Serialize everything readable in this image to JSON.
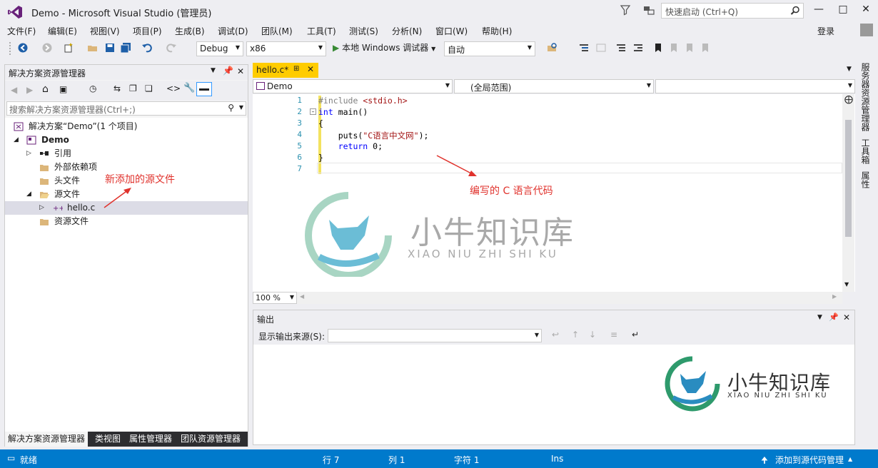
{
  "window": {
    "title": "Demo - Microsoft Visual Studio (管理员)",
    "quick_launch_placeholder": "快速启动 (Ctrl+Q)",
    "login_label": "登录"
  },
  "menu": [
    "文件(F)",
    "编辑(E)",
    "视图(V)",
    "项目(P)",
    "生成(B)",
    "调试(D)",
    "团队(M)",
    "工具(T)",
    "测试(S)",
    "分析(N)",
    "窗口(W)",
    "帮助(H)"
  ],
  "toolbar": {
    "configuration": "Debug",
    "platform": "x86",
    "run_label": "本地 Windows 调试器",
    "auto_label": "自动"
  },
  "solution_explorer": {
    "title": "解决方案资源管理器",
    "search_placeholder": "搜索解决方案资源管理器(Ctrl+;)",
    "tree": [
      {
        "label": "解决方案“Demo”(1 个项目)"
      },
      {
        "label": "Demo"
      },
      {
        "label": "引用"
      },
      {
        "label": "外部依赖项"
      },
      {
        "label": "头文件"
      },
      {
        "label": "源文件"
      },
      {
        "label": "hello.c"
      },
      {
        "label": "资源文件"
      }
    ],
    "tabs": [
      "解决方案资源管理器",
      "类视图",
      "属性管理器",
      "团队资源管理器"
    ]
  },
  "annotations": {
    "new_source": "新添加的源文件",
    "code_note": "编写的 C 语言代码"
  },
  "editor": {
    "tab_label": "hello.c*",
    "nav_project": "Demo",
    "nav_scope": "(全局范围)",
    "nav_member": "",
    "zoom": "100 %",
    "line_numbers": [
      "1",
      "2",
      "3",
      "4",
      "5",
      "6",
      "7"
    ],
    "lines": {
      "l1_pp": "#include ",
      "l1_inc": "<stdio.h>",
      "l2_kw": "int",
      "l2_rest": " main()",
      "l3": "{",
      "l4_a": "    puts(",
      "l4_str": "\"C语言中文网\"",
      "l4_b": ");",
      "l5_kw": "    return",
      "l5_rest": " 0;",
      "l6": "}"
    }
  },
  "output": {
    "title": "输出",
    "source_label": "显示输出来源(S):",
    "source_value": ""
  },
  "watermark": {
    "main": "小牛知识库",
    "sub": "XIAO NIU ZHI SHI KU"
  },
  "right_tabs": [
    "服务器资源管理器",
    "工具箱",
    "属性"
  ],
  "status": {
    "ready": "就绪",
    "row": "行 7",
    "col": "列 1",
    "char": "字符 1",
    "ins": "Ins",
    "scm": "添加到源代码管理"
  },
  "colors": {
    "accent": "#007acc",
    "tab_active": "#ffcc00",
    "annotation": "#e0322c",
    "vs_purple": "#68217a"
  }
}
